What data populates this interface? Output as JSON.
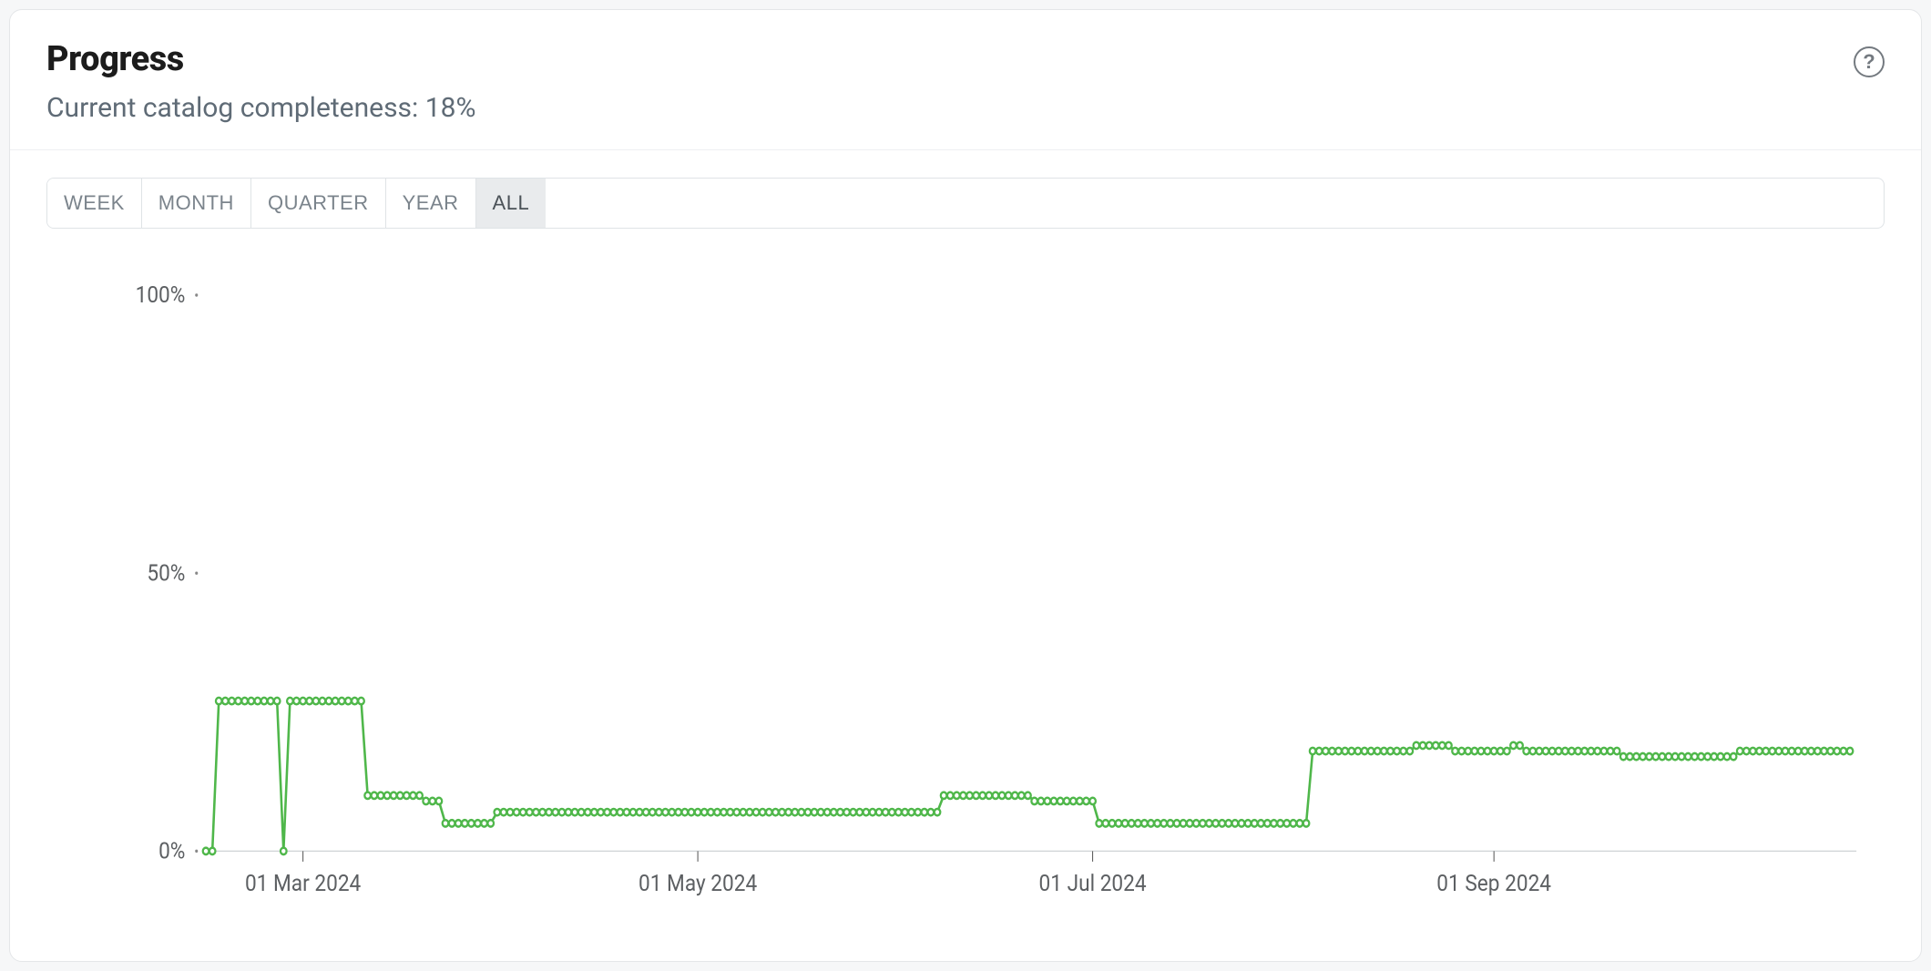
{
  "header": {
    "title": "Progress",
    "subtitle": "Current catalog completeness: 18%"
  },
  "range_tabs": {
    "options": [
      "WEEK",
      "MONTH",
      "QUARTER",
      "YEAR",
      "ALL"
    ],
    "selected": "ALL"
  },
  "chart_data": {
    "type": "line",
    "title": "",
    "xlabel": "",
    "ylabel": "",
    "ylim": [
      0,
      100
    ],
    "y_ticks": [
      {
        "value": 0,
        "label": "0%"
      },
      {
        "value": 50,
        "label": "50%"
      },
      {
        "value": 100,
        "label": "100%"
      }
    ],
    "x_ticks": [
      "01 Mar 2024",
      "01 May 2024",
      "01 Jul 2024",
      "01 Sep 2024"
    ],
    "x_domain_days": 255,
    "x_start_label": "mid-Feb 2024",
    "series": [
      {
        "name": "Catalog completeness",
        "color": "#4fb74a",
        "points": [
          {
            "d": 0,
            "v": 0
          },
          {
            "d": 1,
            "v": 0
          },
          {
            "d": 2,
            "v": 27
          },
          {
            "d": 3,
            "v": 27
          },
          {
            "d": 4,
            "v": 27
          },
          {
            "d": 5,
            "v": 27
          },
          {
            "d": 6,
            "v": 27
          },
          {
            "d": 7,
            "v": 27
          },
          {
            "d": 8,
            "v": 27
          },
          {
            "d": 9,
            "v": 27
          },
          {
            "d": 10,
            "v": 27
          },
          {
            "d": 11,
            "v": 27
          },
          {
            "d": 12,
            "v": 0
          },
          {
            "d": 13,
            "v": 27
          },
          {
            "d": 14,
            "v": 27
          },
          {
            "d": 15,
            "v": 27
          },
          {
            "d": 16,
            "v": 27
          },
          {
            "d": 17,
            "v": 27
          },
          {
            "d": 18,
            "v": 27
          },
          {
            "d": 19,
            "v": 27
          },
          {
            "d": 20,
            "v": 27
          },
          {
            "d": 21,
            "v": 27
          },
          {
            "d": 22,
            "v": 27
          },
          {
            "d": 23,
            "v": 27
          },
          {
            "d": 24,
            "v": 27
          },
          {
            "d": 25,
            "v": 10
          },
          {
            "d": 26,
            "v": 10
          },
          {
            "d": 27,
            "v": 10
          },
          {
            "d": 28,
            "v": 10
          },
          {
            "d": 29,
            "v": 10
          },
          {
            "d": 30,
            "v": 10
          },
          {
            "d": 31,
            "v": 10
          },
          {
            "d": 32,
            "v": 10
          },
          {
            "d": 33,
            "v": 10
          },
          {
            "d": 34,
            "v": 9
          },
          {
            "d": 35,
            "v": 9
          },
          {
            "d": 36,
            "v": 9
          },
          {
            "d": 37,
            "v": 5
          },
          {
            "d": 38,
            "v": 5
          },
          {
            "d": 39,
            "v": 5
          },
          {
            "d": 40,
            "v": 5
          },
          {
            "d": 41,
            "v": 5
          },
          {
            "d": 42,
            "v": 5
          },
          {
            "d": 43,
            "v": 5
          },
          {
            "d": 44,
            "v": 5
          },
          {
            "d": 45,
            "v": 7
          },
          {
            "d": 46,
            "v": 7
          },
          {
            "d": 47,
            "v": 7
          },
          {
            "d": 48,
            "v": 7
          },
          {
            "d": 49,
            "v": 7
          },
          {
            "d": 50,
            "v": 7
          },
          {
            "d": 51,
            "v": 7
          },
          {
            "d": 52,
            "v": 7
          },
          {
            "d": 53,
            "v": 7
          },
          {
            "d": 54,
            "v": 7
          },
          {
            "d": 55,
            "v": 7
          },
          {
            "d": 56,
            "v": 7
          },
          {
            "d": 57,
            "v": 7
          },
          {
            "d": 58,
            "v": 7
          },
          {
            "d": 59,
            "v": 7
          },
          {
            "d": 60,
            "v": 7
          },
          {
            "d": 61,
            "v": 7
          },
          {
            "d": 62,
            "v": 7
          },
          {
            "d": 63,
            "v": 7
          },
          {
            "d": 64,
            "v": 7
          },
          {
            "d": 65,
            "v": 7
          },
          {
            "d": 66,
            "v": 7
          },
          {
            "d": 67,
            "v": 7
          },
          {
            "d": 68,
            "v": 7
          },
          {
            "d": 69,
            "v": 7
          },
          {
            "d": 70,
            "v": 7
          },
          {
            "d": 71,
            "v": 7
          },
          {
            "d": 72,
            "v": 7
          },
          {
            "d": 73,
            "v": 7
          },
          {
            "d": 74,
            "v": 7
          },
          {
            "d": 75,
            "v": 7
          },
          {
            "d": 76,
            "v": 7
          },
          {
            "d": 77,
            "v": 7
          },
          {
            "d": 78,
            "v": 7
          },
          {
            "d": 79,
            "v": 7
          },
          {
            "d": 80,
            "v": 7
          },
          {
            "d": 81,
            "v": 7
          },
          {
            "d": 82,
            "v": 7
          },
          {
            "d": 83,
            "v": 7
          },
          {
            "d": 84,
            "v": 7
          },
          {
            "d": 85,
            "v": 7
          },
          {
            "d": 86,
            "v": 7
          },
          {
            "d": 87,
            "v": 7
          },
          {
            "d": 88,
            "v": 7
          },
          {
            "d": 89,
            "v": 7
          },
          {
            "d": 90,
            "v": 7
          },
          {
            "d": 91,
            "v": 7
          },
          {
            "d": 92,
            "v": 7
          },
          {
            "d": 93,
            "v": 7
          },
          {
            "d": 94,
            "v": 7
          },
          {
            "d": 95,
            "v": 7
          },
          {
            "d": 96,
            "v": 7
          },
          {
            "d": 97,
            "v": 7
          },
          {
            "d": 98,
            "v": 7
          },
          {
            "d": 99,
            "v": 7
          },
          {
            "d": 100,
            "v": 7
          },
          {
            "d": 101,
            "v": 7
          },
          {
            "d": 102,
            "v": 7
          },
          {
            "d": 103,
            "v": 7
          },
          {
            "d": 104,
            "v": 7
          },
          {
            "d": 105,
            "v": 7
          },
          {
            "d": 106,
            "v": 7
          },
          {
            "d": 107,
            "v": 7
          },
          {
            "d": 108,
            "v": 7
          },
          {
            "d": 109,
            "v": 7
          },
          {
            "d": 110,
            "v": 7
          },
          {
            "d": 111,
            "v": 7
          },
          {
            "d": 112,
            "v": 7
          },
          {
            "d": 113,
            "v": 7
          },
          {
            "d": 114,
            "v": 10
          },
          {
            "d": 115,
            "v": 10
          },
          {
            "d": 116,
            "v": 10
          },
          {
            "d": 117,
            "v": 10
          },
          {
            "d": 118,
            "v": 10
          },
          {
            "d": 119,
            "v": 10
          },
          {
            "d": 120,
            "v": 10
          },
          {
            "d": 121,
            "v": 10
          },
          {
            "d": 122,
            "v": 10
          },
          {
            "d": 123,
            "v": 10
          },
          {
            "d": 124,
            "v": 10
          },
          {
            "d": 125,
            "v": 10
          },
          {
            "d": 126,
            "v": 10
          },
          {
            "d": 127,
            "v": 10
          },
          {
            "d": 128,
            "v": 9
          },
          {
            "d": 129,
            "v": 9
          },
          {
            "d": 130,
            "v": 9
          },
          {
            "d": 131,
            "v": 9
          },
          {
            "d": 132,
            "v": 9
          },
          {
            "d": 133,
            "v": 9
          },
          {
            "d": 134,
            "v": 9
          },
          {
            "d": 135,
            "v": 9
          },
          {
            "d": 136,
            "v": 9
          },
          {
            "d": 137,
            "v": 9
          },
          {
            "d": 138,
            "v": 5
          },
          {
            "d": 139,
            "v": 5
          },
          {
            "d": 140,
            "v": 5
          },
          {
            "d": 141,
            "v": 5
          },
          {
            "d": 142,
            "v": 5
          },
          {
            "d": 143,
            "v": 5
          },
          {
            "d": 144,
            "v": 5
          },
          {
            "d": 145,
            "v": 5
          },
          {
            "d": 146,
            "v": 5
          },
          {
            "d": 147,
            "v": 5
          },
          {
            "d": 148,
            "v": 5
          },
          {
            "d": 149,
            "v": 5
          },
          {
            "d": 150,
            "v": 5
          },
          {
            "d": 151,
            "v": 5
          },
          {
            "d": 152,
            "v": 5
          },
          {
            "d": 153,
            "v": 5
          },
          {
            "d": 154,
            "v": 5
          },
          {
            "d": 155,
            "v": 5
          },
          {
            "d": 156,
            "v": 5
          },
          {
            "d": 157,
            "v": 5
          },
          {
            "d": 158,
            "v": 5
          },
          {
            "d": 159,
            "v": 5
          },
          {
            "d": 160,
            "v": 5
          },
          {
            "d": 161,
            "v": 5
          },
          {
            "d": 162,
            "v": 5
          },
          {
            "d": 163,
            "v": 5
          },
          {
            "d": 164,
            "v": 5
          },
          {
            "d": 165,
            "v": 5
          },
          {
            "d": 166,
            "v": 5
          },
          {
            "d": 167,
            "v": 5
          },
          {
            "d": 168,
            "v": 5
          },
          {
            "d": 169,
            "v": 5
          },
          {
            "d": 170,
            "v": 5
          },
          {
            "d": 171,
            "v": 18
          },
          {
            "d": 172,
            "v": 18
          },
          {
            "d": 173,
            "v": 18
          },
          {
            "d": 174,
            "v": 18
          },
          {
            "d": 175,
            "v": 18
          },
          {
            "d": 176,
            "v": 18
          },
          {
            "d": 177,
            "v": 18
          },
          {
            "d": 178,
            "v": 18
          },
          {
            "d": 179,
            "v": 18
          },
          {
            "d": 180,
            "v": 18
          },
          {
            "d": 181,
            "v": 18
          },
          {
            "d": 182,
            "v": 18
          },
          {
            "d": 183,
            "v": 18
          },
          {
            "d": 184,
            "v": 18
          },
          {
            "d": 185,
            "v": 18
          },
          {
            "d": 186,
            "v": 18
          },
          {
            "d": 187,
            "v": 19
          },
          {
            "d": 188,
            "v": 19
          },
          {
            "d": 189,
            "v": 19
          },
          {
            "d": 190,
            "v": 19
          },
          {
            "d": 191,
            "v": 19
          },
          {
            "d": 192,
            "v": 19
          },
          {
            "d": 193,
            "v": 18
          },
          {
            "d": 194,
            "v": 18
          },
          {
            "d": 195,
            "v": 18
          },
          {
            "d": 196,
            "v": 18
          },
          {
            "d": 197,
            "v": 18
          },
          {
            "d": 198,
            "v": 18
          },
          {
            "d": 199,
            "v": 18
          },
          {
            "d": 200,
            "v": 18
          },
          {
            "d": 201,
            "v": 18
          },
          {
            "d": 202,
            "v": 19
          },
          {
            "d": 203,
            "v": 19
          },
          {
            "d": 204,
            "v": 18
          },
          {
            "d": 205,
            "v": 18
          },
          {
            "d": 206,
            "v": 18
          },
          {
            "d": 207,
            "v": 18
          },
          {
            "d": 208,
            "v": 18
          },
          {
            "d": 209,
            "v": 18
          },
          {
            "d": 210,
            "v": 18
          },
          {
            "d": 211,
            "v": 18
          },
          {
            "d": 212,
            "v": 18
          },
          {
            "d": 213,
            "v": 18
          },
          {
            "d": 214,
            "v": 18
          },
          {
            "d": 215,
            "v": 18
          },
          {
            "d": 216,
            "v": 18
          },
          {
            "d": 217,
            "v": 18
          },
          {
            "d": 218,
            "v": 18
          },
          {
            "d": 219,
            "v": 17
          },
          {
            "d": 220,
            "v": 17
          },
          {
            "d": 221,
            "v": 17
          },
          {
            "d": 222,
            "v": 17
          },
          {
            "d": 223,
            "v": 17
          },
          {
            "d": 224,
            "v": 17
          },
          {
            "d": 225,
            "v": 17
          },
          {
            "d": 226,
            "v": 17
          },
          {
            "d": 227,
            "v": 17
          },
          {
            "d": 228,
            "v": 17
          },
          {
            "d": 229,
            "v": 17
          },
          {
            "d": 230,
            "v": 17
          },
          {
            "d": 231,
            "v": 17
          },
          {
            "d": 232,
            "v": 17
          },
          {
            "d": 233,
            "v": 17
          },
          {
            "d": 234,
            "v": 17
          },
          {
            "d": 235,
            "v": 17
          },
          {
            "d": 236,
            "v": 17
          },
          {
            "d": 237,
            "v": 18
          },
          {
            "d": 238,
            "v": 18
          },
          {
            "d": 239,
            "v": 18
          },
          {
            "d": 240,
            "v": 18
          },
          {
            "d": 241,
            "v": 18
          },
          {
            "d": 242,
            "v": 18
          },
          {
            "d": 243,
            "v": 18
          },
          {
            "d": 244,
            "v": 18
          },
          {
            "d": 245,
            "v": 18
          },
          {
            "d": 246,
            "v": 18
          },
          {
            "d": 247,
            "v": 18
          },
          {
            "d": 248,
            "v": 18
          },
          {
            "d": 249,
            "v": 18
          },
          {
            "d": 250,
            "v": 18
          },
          {
            "d": 251,
            "v": 18
          },
          {
            "d": 252,
            "v": 18
          },
          {
            "d": 253,
            "v": 18
          },
          {
            "d": 254,
            "v": 18
          }
        ]
      }
    ]
  }
}
